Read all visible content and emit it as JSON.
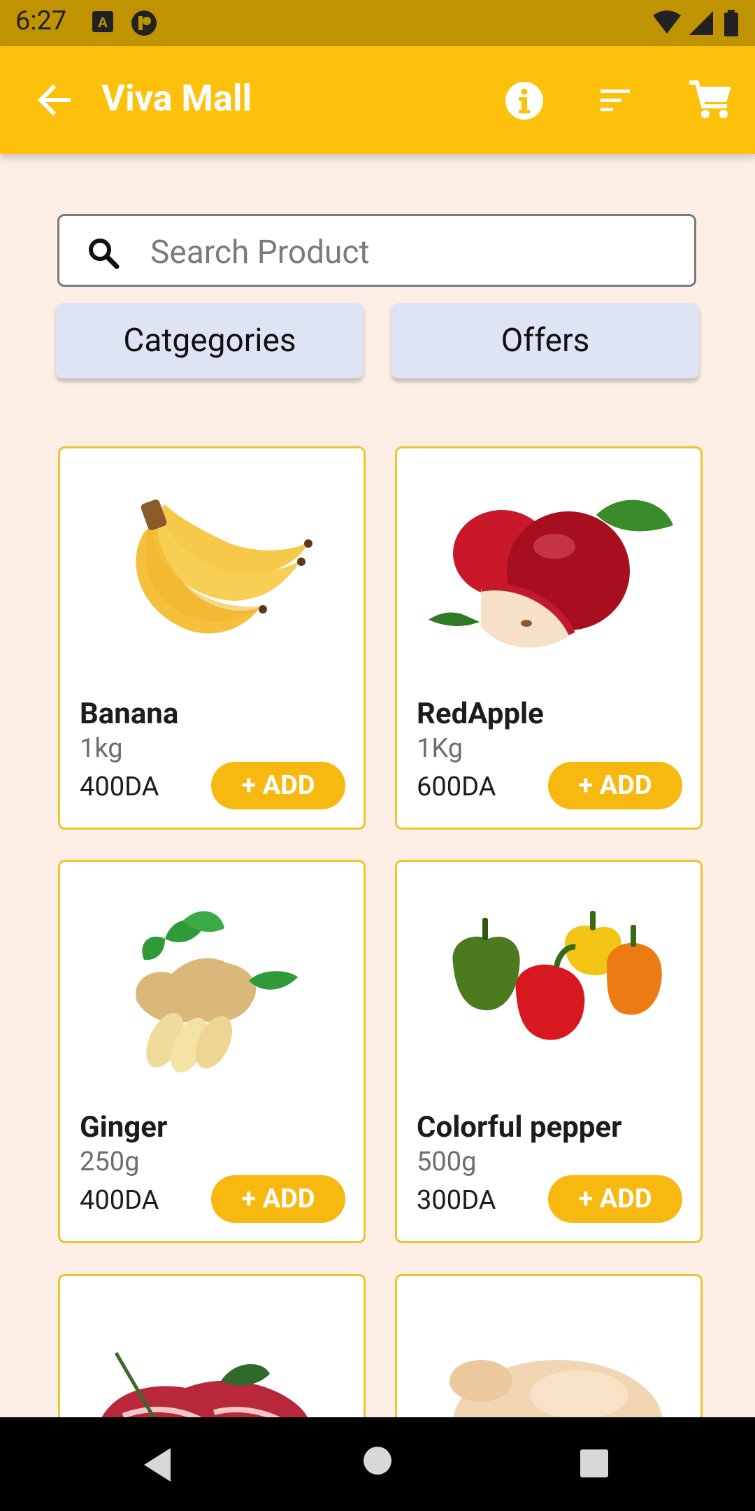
{
  "status_bar": {
    "time": "6:27"
  },
  "app_bar": {
    "title": "Viva Mall",
    "icons": [
      "back-arrow-icon",
      "info-icon",
      "sort-icon",
      "cart-icon"
    ]
  },
  "search": {
    "placeholder": "Search Product"
  },
  "buttons": {
    "categories": "Catgegories",
    "offers": "Offers"
  },
  "add_label": "+ ADD",
  "products": [
    {
      "name": "Banana",
      "qty": "1kg",
      "price": "400DA"
    },
    {
      "name": "RedApple",
      "qty": "1Kg",
      "price": "600DA"
    },
    {
      "name": "Ginger",
      "qty": "250g",
      "price": "400DA"
    },
    {
      "name": "Colorful pepper",
      "qty": "500g",
      "price": "300DA"
    }
  ],
  "colors": {
    "app_bar": "#fdc10b",
    "status_bar": "#bf9400",
    "add_button": "#f7b90f",
    "card_border": "#f1c232",
    "background": "#fdeee6",
    "chip": "#dfe4f4"
  }
}
